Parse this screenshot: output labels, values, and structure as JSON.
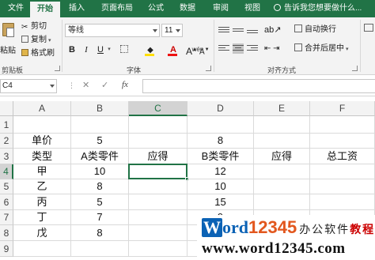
{
  "ribbon_tabs": [
    "文件",
    "开始",
    "插入",
    "页面布局",
    "公式",
    "数据",
    "审阅",
    "视图"
  ],
  "tell_me": "告诉我您想要做什么...",
  "clipboard": {
    "paste": "粘贴",
    "cut": "剪切",
    "copy": "复制",
    "format_painter": "格式刷",
    "group": "剪贴板"
  },
  "font": {
    "name": "等线",
    "size": "11",
    "bold": "B",
    "italic": "I",
    "underline": "U",
    "grow": "A",
    "shrink": "A",
    "font_color_glyph": "A",
    "wen": "wén",
    "group": "字体"
  },
  "alignment": {
    "wrap_text": "自动换行",
    "merge_center": "合并后居中",
    "group": "对齐方式"
  },
  "formula_bar": {
    "name_box": "C4",
    "cancel": "✕",
    "enter": "✓",
    "fx": "fx",
    "content": ""
  },
  "columns": [
    "A",
    "B",
    "C",
    "D",
    "E",
    "F"
  ],
  "rows": [
    "1",
    "2",
    "3",
    "4",
    "5",
    "6",
    "7",
    "8",
    "9"
  ],
  "cells": {
    "A2": "单价",
    "B2": "5",
    "D2": "8",
    "A3": "类型",
    "B3": "A类零件",
    "C3": "应得",
    "D3": "B类零件",
    "E3": "应得",
    "F3": "总工资",
    "A4": "甲",
    "B4": "10",
    "D4": "12",
    "A5": "乙",
    "B5": "8",
    "D5": "10",
    "A6": "丙",
    "B6": "5",
    "D6": "15",
    "A7": "丁",
    "B7": "7",
    "D7": "9",
    "A8": "戊",
    "B8": "8"
  },
  "selected_cell": "C4",
  "watermark": {
    "w": "W",
    "ord": "ord",
    "digits": "12345",
    "tagline1": "办公软件",
    "tagline2": "教程",
    "url": "www.word12345.com"
  },
  "colors": {
    "excel_green": "#217346",
    "watermark_blue": "#0b62b5",
    "watermark_orange": "#e2571e"
  }
}
